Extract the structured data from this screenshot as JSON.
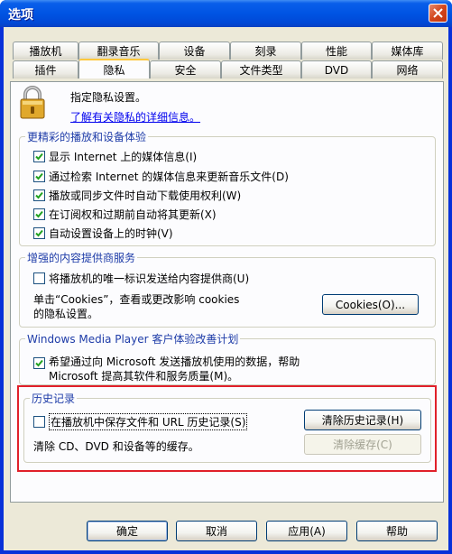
{
  "window": {
    "title": "选项",
    "close_label": "close"
  },
  "tabs_row1": [
    {
      "label": "播放机"
    },
    {
      "label": "翻录音乐"
    },
    {
      "label": "设备"
    },
    {
      "label": "刻录"
    },
    {
      "label": "性能"
    },
    {
      "label": "媒体库"
    }
  ],
  "tabs_row2": [
    {
      "label": "插件"
    },
    {
      "label": "隐私"
    },
    {
      "label": "安全"
    },
    {
      "label": "文件类型"
    },
    {
      "label": "DVD"
    },
    {
      "label": "网络"
    }
  ],
  "header": {
    "description": "指定隐私设置。",
    "link": "了解有关隐私的详细信息。",
    "icon": "lock-icon"
  },
  "group_playback": {
    "title": "更精彩的播放和设备体验",
    "items": [
      {
        "label": "显示 Internet 上的媒体信息(I)",
        "checked": true
      },
      {
        "label": "通过检索 Internet 的媒体信息来更新音乐文件(D)",
        "checked": true
      },
      {
        "label": "播放或同步文件时自动下载使用权利(W)",
        "checked": true
      },
      {
        "label": "在订阅权和过期前自动将其更新(X)",
        "checked": true
      },
      {
        "label": "自动设置设备上的时钟(V)",
        "checked": true
      }
    ]
  },
  "group_content": {
    "title": "增强的内容提供商服务",
    "checkbox_label": "将播放机的唯一标识发送给内容提供商(U)",
    "checked": false,
    "cookies_text_1": "单击“Cookies”，查看或更改影响 cookies",
    "cookies_text_2": "的隐私设置。",
    "cookies_button": "Cookies(O)..."
  },
  "group_ceip": {
    "title": "Windows Media Player 客户体验改善计划",
    "checkbox_line1": "希望通过向 Microsoft 发送播放机使用的数据，帮助",
    "checkbox_line2": "Microsoft 提高其软件和服务质量(M)。",
    "checked": true
  },
  "group_history": {
    "title": "历史记录",
    "checkbox_label": "在播放机中保存文件和 URL 历史记录(S)",
    "checked": false,
    "clear_history_button": "清除历史记录(H)",
    "cache_text": "清除 CD、DVD 和设备等的缓存。",
    "clear_cache_button": "清除缓存(C)"
  },
  "footer": {
    "ok": "确定",
    "cancel": "取消",
    "apply": "应用(A)",
    "help": "帮助"
  },
  "colors": {
    "title_bar": "#0054e3",
    "dialog_bg": "#ece9d8",
    "group_title": "#1e3ca8",
    "highlight_box": "#e0202a"
  }
}
